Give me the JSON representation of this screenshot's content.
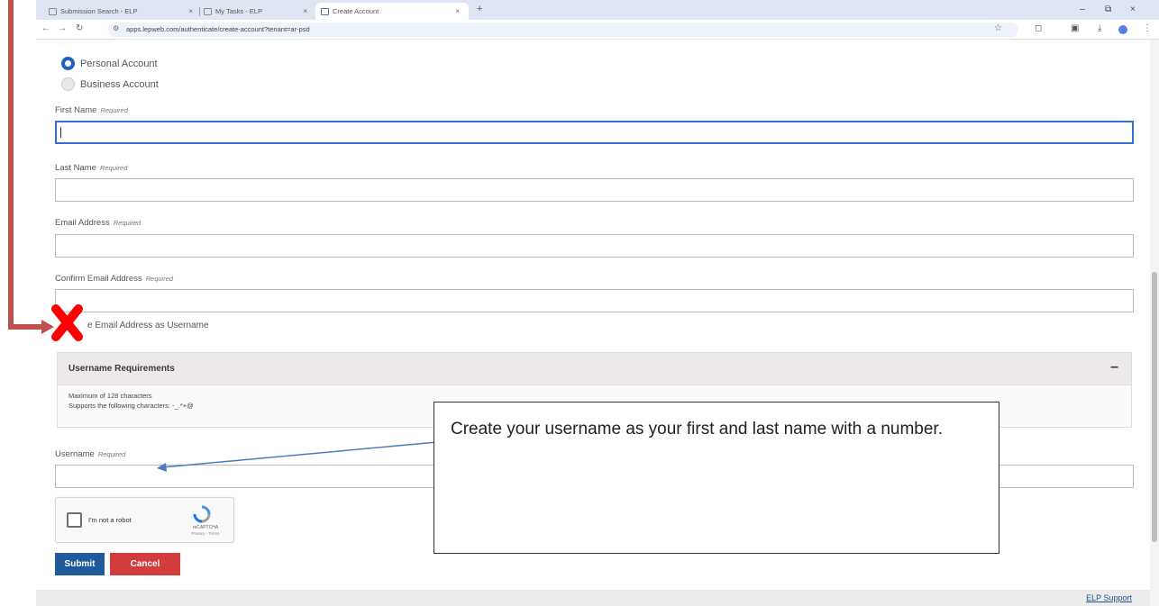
{
  "browser": {
    "tabs": [
      {
        "title": "Submission Search - ELP"
      },
      {
        "title": "My Tasks - ELP"
      },
      {
        "title": "Create Account"
      }
    ],
    "new_tab": "+",
    "tab_close": "×",
    "url": "apps.lepweb.com/authenticate/create-account?tenant=ar-psd",
    "window_controls": {
      "minimize": "–",
      "restore": "⧉",
      "close": "×"
    }
  },
  "account_type": {
    "options": [
      {
        "label": "Personal Account",
        "selected": true
      },
      {
        "label": "Business Account",
        "selected": false
      }
    ]
  },
  "form": {
    "required_text": "Required",
    "first_name": {
      "label": "First Name",
      "value": ""
    },
    "last_name": {
      "label": "Last Name",
      "value": ""
    },
    "email": {
      "label": "Email Address",
      "value": ""
    },
    "confirm_email": {
      "label": "Confirm Email Address",
      "value": ""
    },
    "use_email_label": "e Email Address as Username",
    "username": {
      "label": "Username",
      "value": ""
    }
  },
  "requirements": {
    "title": "Username Requirements",
    "collapse_symbol": "–",
    "lines": [
      "Maximum of 128 characters",
      "Supports the following characters: -_.*+@"
    ]
  },
  "recaptcha": {
    "label": "I'm not a robot",
    "brand": "reCAPTCHA",
    "terms": "Privacy - Terms"
  },
  "buttons": {
    "submit": "Submit",
    "cancel": "Cancel"
  },
  "footer": {
    "support_link": "ELP Support"
  },
  "annotation": {
    "callout_text": "Create your username as your first and last name with a number.",
    "marker_color": "#ff0000",
    "arrow_color": "#c0504d"
  }
}
